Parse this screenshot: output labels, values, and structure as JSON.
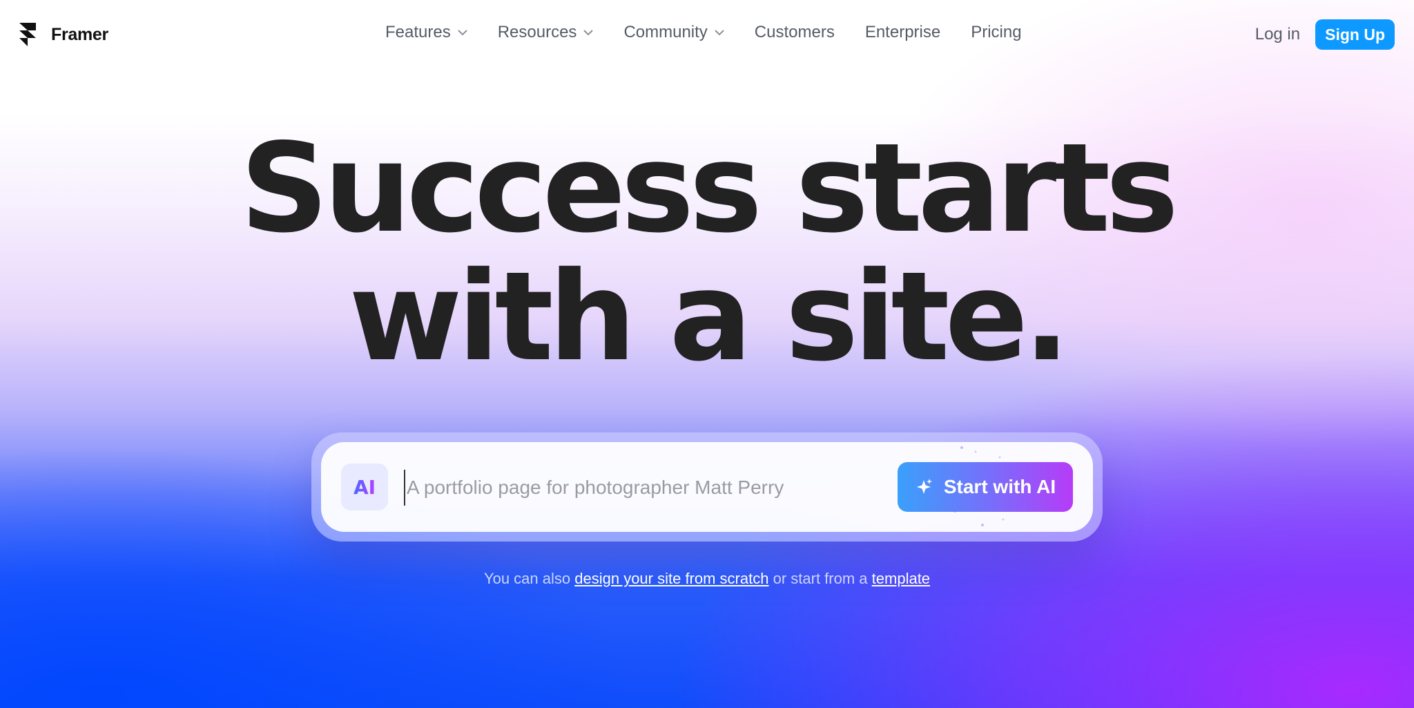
{
  "brand": {
    "name": "Framer"
  },
  "nav": {
    "items": [
      {
        "label": "Features",
        "dropdown": true
      },
      {
        "label": "Resources",
        "dropdown": true
      },
      {
        "label": "Community",
        "dropdown": true
      },
      {
        "label": "Customers",
        "dropdown": false
      },
      {
        "label": "Enterprise",
        "dropdown": false
      },
      {
        "label": "Pricing",
        "dropdown": false
      }
    ]
  },
  "auth": {
    "login_label": "Log in",
    "signup_label": "Sign Up"
  },
  "hero": {
    "line1": "Success starts",
    "line2": "with a site."
  },
  "prompt": {
    "badge": "AI",
    "placeholder": "A portfolio page for photographer Matt Perry",
    "value": "",
    "button_label": "Start with AI"
  },
  "alt": {
    "prefix": "You can also",
    "link1": "design your site from scratch",
    "middle": "or start from a",
    "link2": "template"
  },
  "colors": {
    "accent": "#0d99ff",
    "gradient_start": "#3aa0fb",
    "gradient_end": "#b63cf7",
    "heading": "#222222"
  },
  "icons": [
    "framer-logo-icon",
    "chevron-down-icon",
    "ai-badge-icon",
    "sparkle-icon"
  ]
}
